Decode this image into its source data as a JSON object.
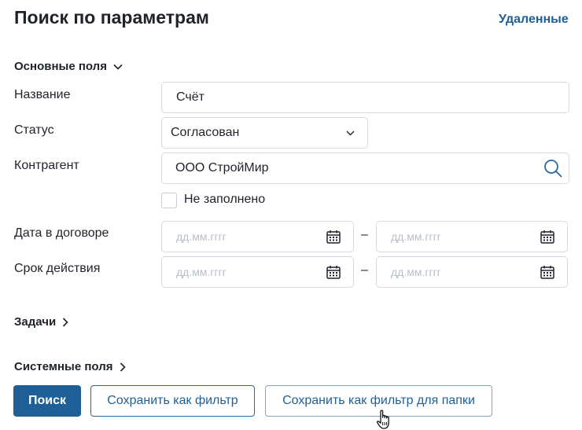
{
  "header": {
    "title": "Поиск по параметрам",
    "deleted_link": "Удаленные"
  },
  "sections": {
    "main_fields": "Основные поля",
    "tasks": "Задачи",
    "system_fields": "Системные поля"
  },
  "fields": {
    "name": {
      "label": "Название",
      "value": "Счёт"
    },
    "status": {
      "label": "Статус",
      "value": "Согласован"
    },
    "counterparty": {
      "label": "Контрагент",
      "value": "ООО СтройМир"
    },
    "not_filled": {
      "label": "Не заполнено",
      "checked": false
    },
    "contract_date": {
      "label": "Дата в договоре",
      "from_placeholder": "дд.мм.гггг",
      "to_placeholder": "дд.мм.гггг"
    },
    "validity": {
      "label": "Срок действия",
      "from_placeholder": "дд.мм.гггг",
      "to_placeholder": "дд.мм.гггг"
    },
    "range_separator": "–"
  },
  "buttons": {
    "search": "Поиск",
    "save_filter": "Сохранить как фильтр",
    "save_filter_folder": "Сохранить как фильтр для папки"
  },
  "icons": {
    "chevron": "chevron-down-icon",
    "search": "search-icon",
    "calendar": "calendar-icon",
    "cursor": "hand-pointer-icon"
  },
  "colors": {
    "accent": "#1f5f97",
    "border": "#d6dae0",
    "placeholder": "#b9bfc7"
  }
}
